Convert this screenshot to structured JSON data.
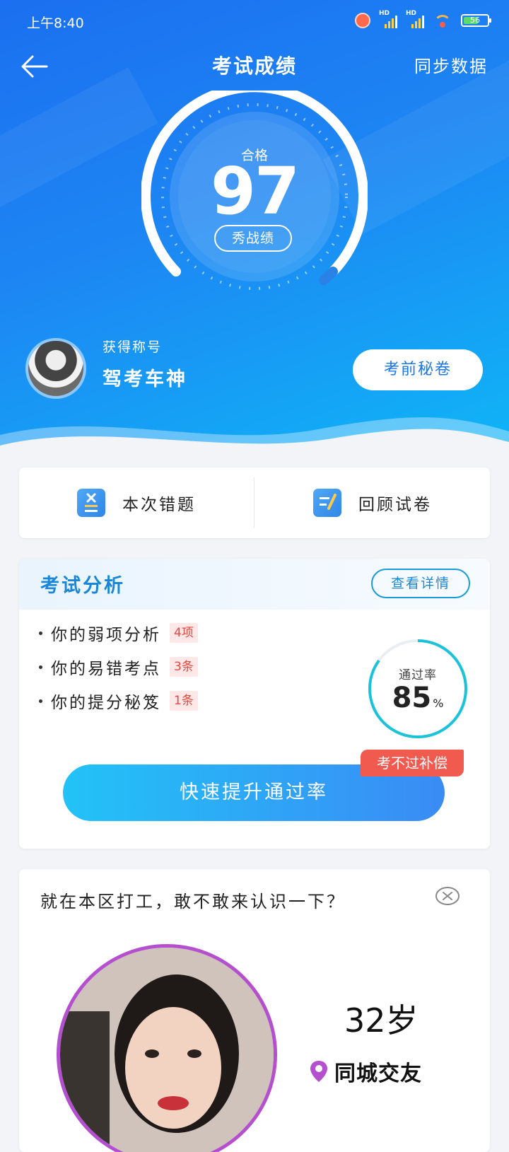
{
  "status_bar": {
    "time": "上午8:40",
    "hd_label": "HD",
    "battery": "56"
  },
  "header": {
    "title": "考试成绩",
    "sync_label": "同步数据"
  },
  "score": {
    "status": "合格",
    "value": "97",
    "share_label": "秀战绩"
  },
  "profile": {
    "title_label": "获得称号",
    "title_value": "驾考车神",
    "secret_button": "考前秘卷"
  },
  "quick_actions": {
    "wrong_label": "本次错题",
    "review_label": "回顾试卷"
  },
  "analysis": {
    "title": "考试分析",
    "detail_button": "查看详情",
    "items": [
      {
        "label": "你的弱项分析",
        "badge": "4项"
      },
      {
        "label": "你的易错考点",
        "badge": "3条"
      },
      {
        "label": "你的提分秘笈",
        "badge": "1条"
      }
    ],
    "pass_label": "通过率",
    "pass_value": "85",
    "pass_unit": "%",
    "pass_fraction": 0.85,
    "boost_button": "快速提升通过率",
    "compensation_tag": "考不过补偿"
  },
  "ad": {
    "text": "就在本区打工，敢不敢来认识一下？",
    "age": "32岁",
    "location": "同城交友"
  },
  "icons": {
    "back": "back-arrow-icon",
    "wrong": "wrong-questions-icon",
    "review": "review-paper-icon",
    "close": "close-icon",
    "location": "location-pin-icon"
  },
  "colors": {
    "hero_start": "#1b6ff0",
    "hero_end": "#0fb6f7",
    "accent": "#1a86d8",
    "badge_red": "#e8493f",
    "ring": "#1bc3d8",
    "ad_purple": "#b44fd0"
  }
}
